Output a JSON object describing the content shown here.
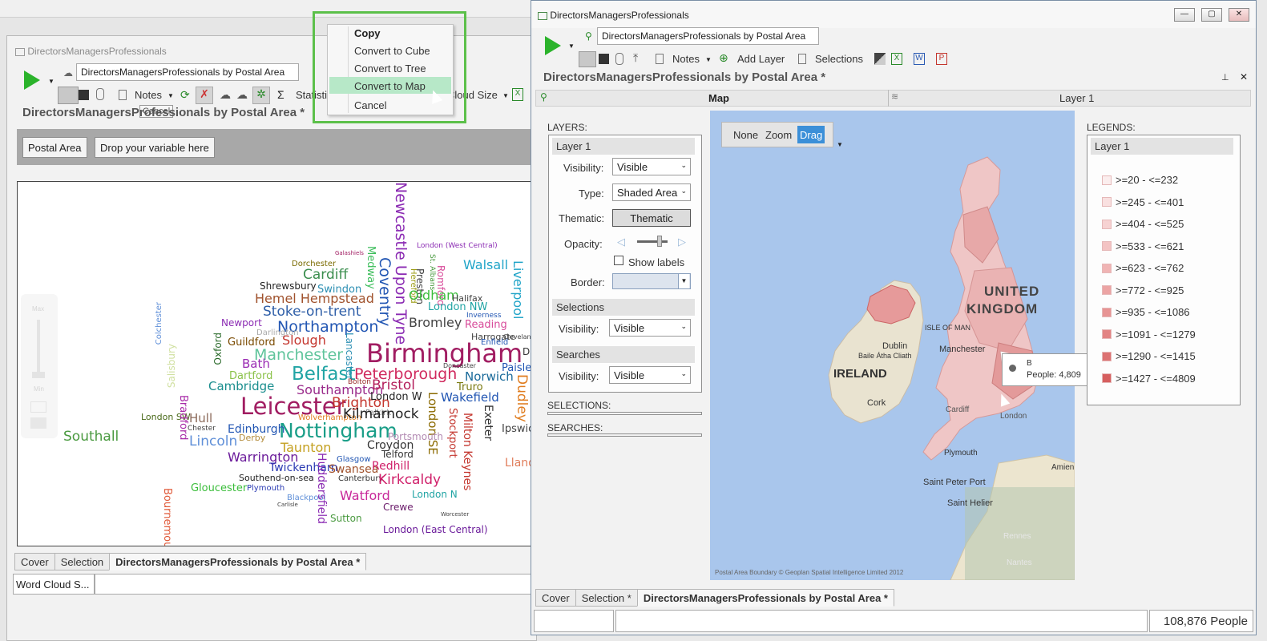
{
  "left_window": {
    "title": "DirectorsManagersProfessionals",
    "table_name": "DirectorsManagersProfessionals by Postal Area",
    "heading": "DirectorsManagersProfessionals by Postal Area *",
    "toolbar": {
      "notes": "Notes",
      "statistics": "Statistic",
      "cloud_size": "Cloud Size"
    },
    "tooltip": "Cancel",
    "drop_zone": {
      "postal_area": "Postal Area",
      "drop": "Drop your variable here"
    },
    "slider": {
      "max": "Max",
      "min": "Min"
    },
    "tabs": [
      "Cover",
      "Selection",
      "DirectorsManagersProfessionals by Postal Area *"
    ],
    "status": "Word Cloud S...",
    "context_menu": [
      "Copy",
      "Convert to Cube",
      "Convert to Tree",
      "Convert to Map",
      "Cancel"
    ]
  },
  "word_cloud": [
    "Birmingham",
    "Leicester",
    "Nottingham",
    "Belfast",
    "Peterborough",
    "Manchester",
    "Northampton",
    "Stoke-on-trent",
    "Hemel Hempstead",
    "Cardiff",
    "Swindon",
    "Shrewsbury",
    "Dorchester",
    "Galashiels",
    "Newcastle Upon Tyne",
    "Coventry",
    "Medway",
    "Hereford",
    "Preston",
    "Romford",
    "St. Albans",
    "Llandrindod Wells",
    "London (West Central)",
    "Walsall",
    "Liverpool",
    "Oldham",
    "London NW",
    "Halifax",
    "Inverness",
    "Ilford",
    "Bromley",
    "Reading",
    "Cleveland",
    "Harrogate",
    "Enfield",
    "Lancaster",
    "Slough",
    "Guildford",
    "Newport",
    "Darlington",
    "Bath",
    "Oxford",
    "Dartford",
    "Cambridge",
    "Southampton",
    "Brighton",
    "Bristol",
    "Norwich",
    "Doncaster",
    "Paisley",
    "Bolton",
    "Falkirk",
    "Truro",
    "London W",
    "Wakefield",
    "London SE",
    "Dudley",
    "Stockport",
    "Exeter",
    "Milton Keynes",
    "Ipswich",
    "Hull",
    "Wolverhampton",
    "Kilmarnock",
    "London SW",
    "Southall",
    "Bradford",
    "Edinburgh",
    "Chester",
    "Lincoln",
    "Derby",
    "Taunton",
    "Portsmouth",
    "Croydon",
    "Warrington",
    "Glasgow",
    "Telford",
    "Twickenham",
    "Swansea",
    "Redhill",
    "Southend-on-sea",
    "Canterbury",
    "Kirkcaldy",
    "Gloucester",
    "Plymouth",
    "Blackpool",
    "Carlisle",
    "Watford",
    "London N",
    "Crewe",
    "Worcester",
    "Sutton",
    "London (East Central)",
    "Huddersfield",
    "Bournemouth",
    "Colchester",
    "Salisbury",
    "Llandudno",
    "Steve",
    "Dundee",
    "Ma"
  ],
  "right_window": {
    "title": "DirectorsManagersProfessionals",
    "table_name": "DirectorsManagersProfessionals by Postal Area",
    "heading": "DirectorsManagersProfessionals by Postal Area *",
    "toolbar": {
      "notes": "Notes",
      "add_layer": "Add Layer",
      "selections": "Selections"
    },
    "map_tabs": [
      "Map",
      "Layer 1"
    ],
    "layers": {
      "header": "LAYERS:",
      "layer_name": "Layer 1",
      "visibility_label": "Visibility:",
      "visibility": "Visible",
      "type_label": "Type:",
      "type": "Shaded Area",
      "thematic_label": "Thematic:",
      "thematic": "Thematic",
      "opacity_label": "Opacity:",
      "show_labels": "Show labels",
      "border_label": "Border:",
      "selections_header": "Selections",
      "sel_visibility": "Visible",
      "searches_header": "Searches",
      "search_visibility": "Visible",
      "selections_section": "SELECTIONS:",
      "searches_section": "SEARCHES:"
    },
    "nav_modes": [
      "None",
      "Zoom",
      "Drag"
    ],
    "map_labels": {
      "uk1": "UNITED",
      "uk2": "KINGDOM",
      "ireland": "IRELAND",
      "dublin": "Dublin",
      "baile": "Baile Átha Cliath",
      "cork": "Cork",
      "manchester": "Manchester",
      "isle": "ISLE OF MAN",
      "cardiff": "Cardiff",
      "london": "London",
      "plymouth": "Plymouth",
      "saint_peter": "Saint Peter Port",
      "saint_helier": "Saint Helier",
      "rennes": "Rennes",
      "nantes": "Nantes",
      "amiens": "Amien",
      "copyright": "Postal Area Boundary © Geoplan Spatial Intelligence Limited 2012"
    },
    "tooltip": {
      "title": "B",
      "value": "People: 4,809"
    },
    "legend": {
      "header": "LEGENDS:",
      "layer": "Layer 1",
      "items": [
        ">=20 - <=232",
        ">=245 - <=401",
        ">=404 - <=525",
        ">=533 - <=621",
        ">=623 - <=762",
        ">=772 - <=925",
        ">=935 - <=1086",
        ">=1091 - <=1279",
        ">=1290 - <=1415",
        ">=1427 - <=4809"
      ],
      "colors": [
        "#fbeeee",
        "#f9e0e0",
        "#f6d2d2",
        "#f3c3c3",
        "#f0b4b4",
        "#eca4a4",
        "#e79494",
        "#e28383",
        "#dc7272",
        "#d65f5f"
      ]
    },
    "tabs": [
      "Cover",
      "Selection *",
      "DirectorsManagersProfessionals by Postal Area *"
    ],
    "status_count": "108,876 People"
  }
}
